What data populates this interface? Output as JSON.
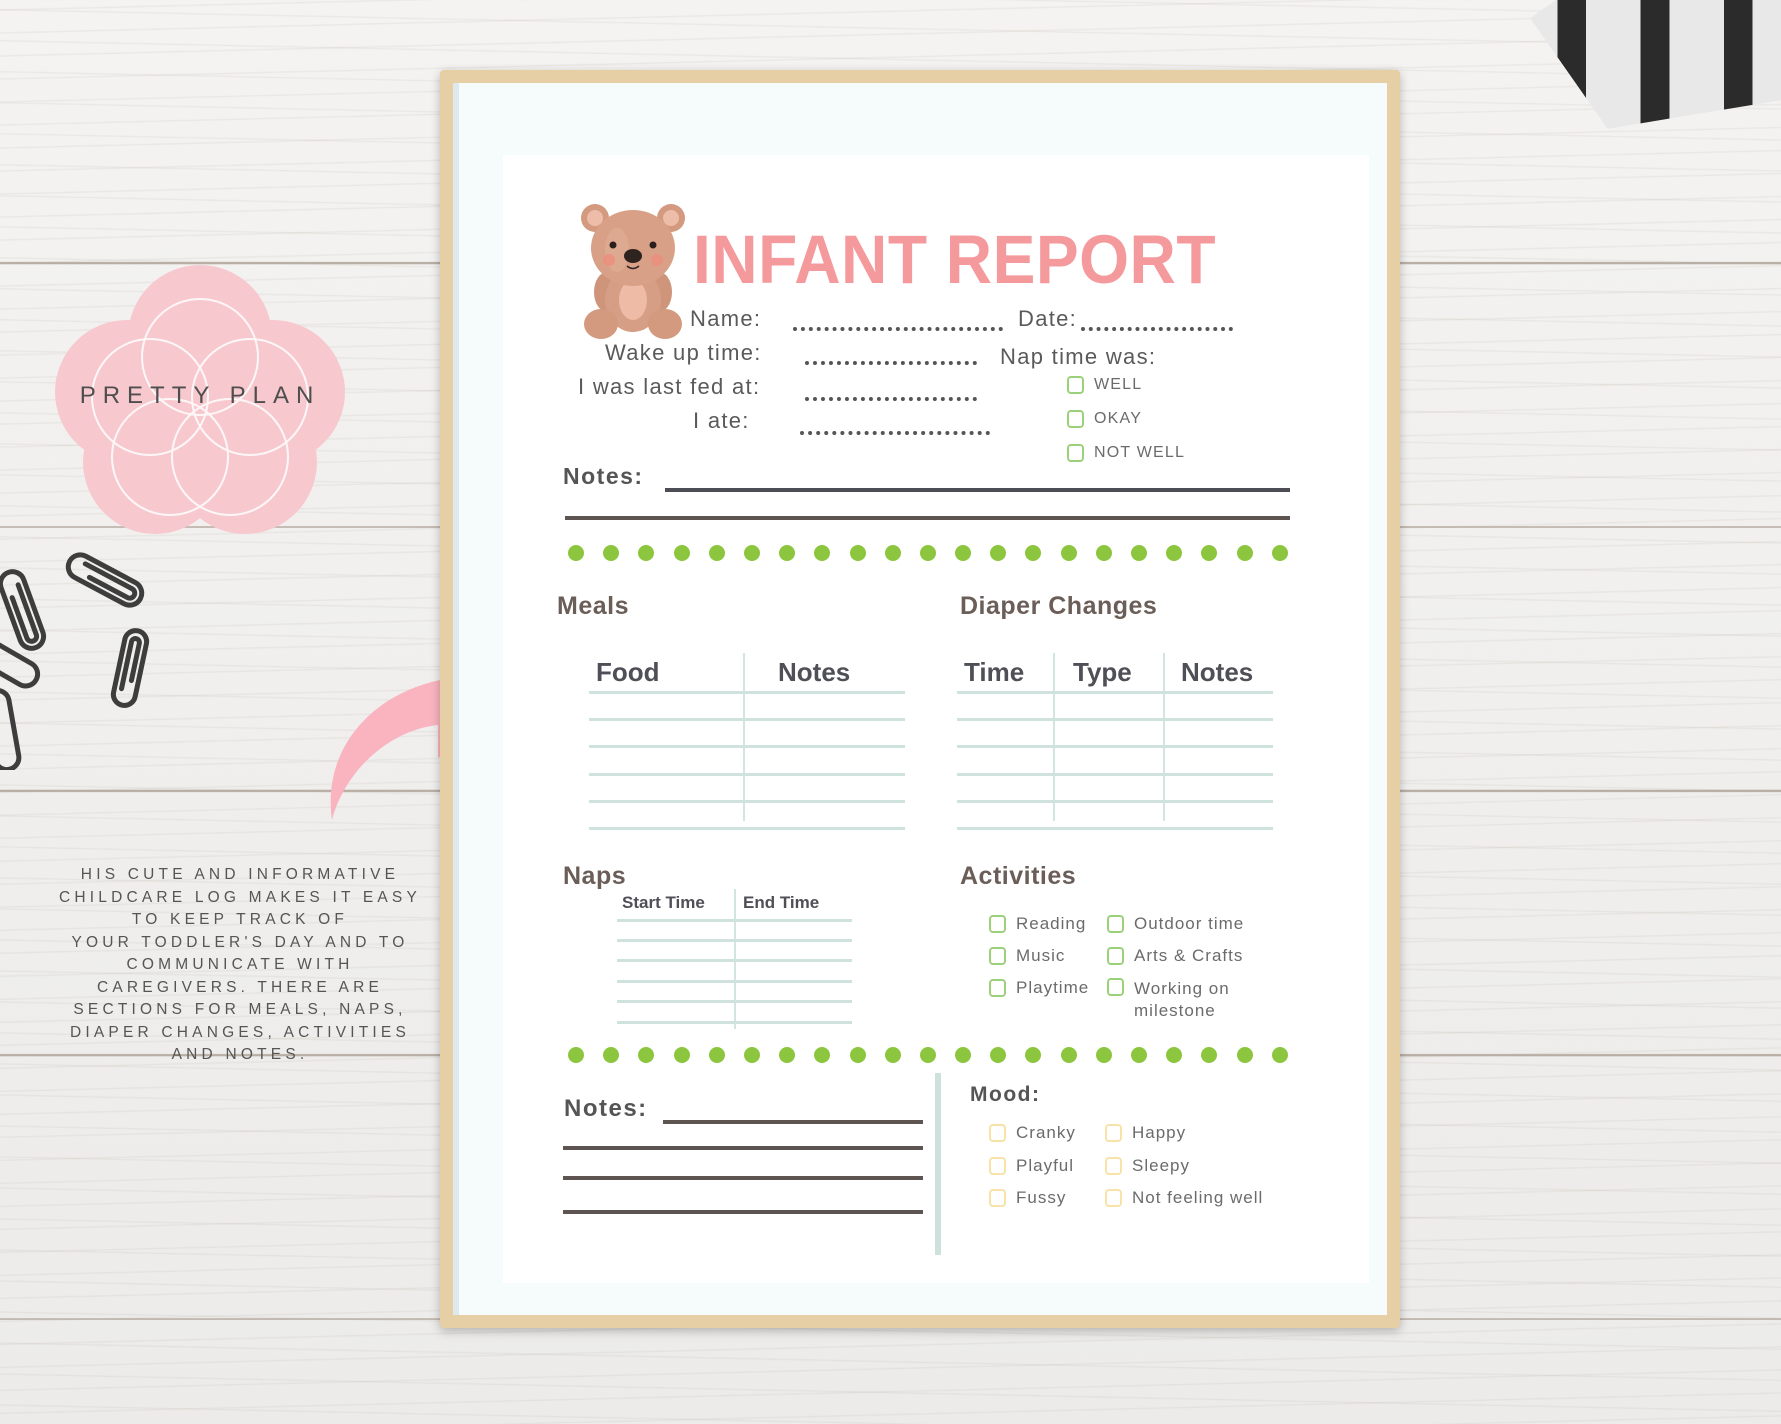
{
  "brand": {
    "logo_text": "PRETTY PLAN",
    "logo_color": "#f7c9cf"
  },
  "description": {
    "lines": [
      "HIS CUTE AND INFORMATIVE",
      "CHILDCARE LOG MAKES IT EASY",
      "TO KEEP TRACK OF",
      "YOUR TODDLER'S DAY AND TO",
      "COMMUNICATE WITH",
      "CAREGIVERS. THERE ARE",
      "SECTIONS FOR MEALS, NAPS,",
      "DIAPER CHANGES, ACTIVITIES",
      "AND NOTES."
    ]
  },
  "decor": {
    "arrow": "curved-arrow-icon",
    "arrow_color": "#f9b4c0",
    "paperclips": "paperclip-icon",
    "stripes": "striped-object"
  },
  "sheet": {
    "title": "INFANT REPORT",
    "title_color": "#f59a9c",
    "accent_green": "#8cc63f",
    "mascot": "teddy-bear-icon",
    "fields": {
      "name": "Name:",
      "date": "Date:",
      "wake_up": "Wake up time:",
      "last_fed": "I was last fed at:",
      "ate": "I ate:",
      "nap_time": "Nap time was:"
    },
    "nap_quality_options": [
      "WELL",
      "OKAY",
      "NOT WELL"
    ],
    "notes_label": "Notes:",
    "meals": {
      "title": "Meals",
      "columns": [
        "Food",
        "Notes"
      ],
      "blank_rows": 5
    },
    "diaper": {
      "title": "Diaper Changes",
      "columns": [
        "Time",
        "Type",
        "Notes"
      ],
      "blank_rows": 5
    },
    "naps": {
      "title": "Naps",
      "columns": [
        "Start Time",
        "End Time"
      ],
      "blank_rows": 5
    },
    "activities": {
      "title": "Activities",
      "options": [
        "Reading",
        "Outdoor time",
        "Music",
        "Arts & Crafts",
        "Playtime",
        "Working on",
        "milestone"
      ]
    },
    "bottom_notes_label": "Notes:",
    "mood": {
      "title": "Mood:",
      "options": [
        "Cranky",
        "Happy",
        "Playful",
        "Sleepy",
        "Fussy",
        "Not feeling well"
      ]
    }
  }
}
